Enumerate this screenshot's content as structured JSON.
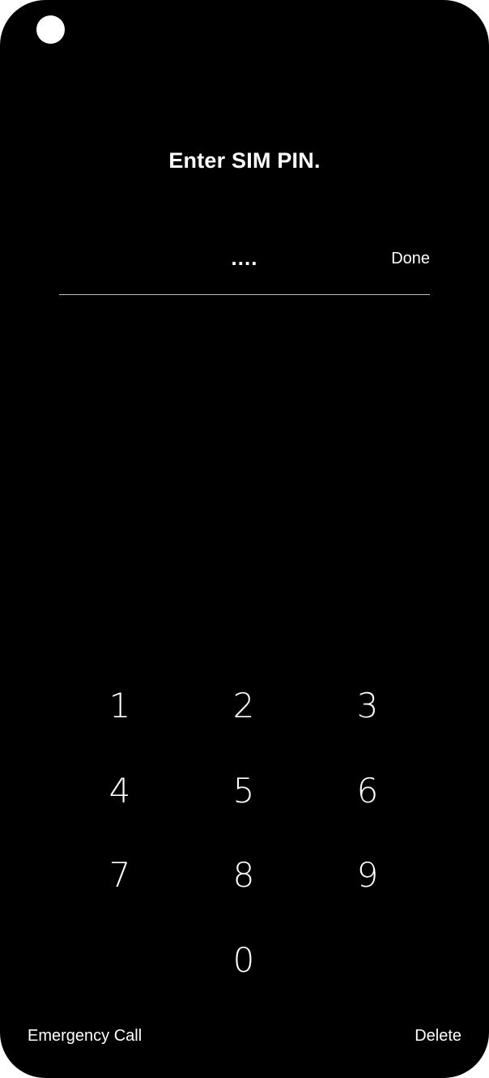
{
  "screen": {
    "title": "Enter SIM PIN.",
    "pin_display": "....",
    "done_label": "Done"
  },
  "keypad": {
    "keys": [
      "1",
      "2",
      "3",
      "4",
      "5",
      "6",
      "7",
      "8",
      "9",
      "0"
    ]
  },
  "footer": {
    "emergency_label": "Emergency Call",
    "delete_label": "Delete"
  }
}
